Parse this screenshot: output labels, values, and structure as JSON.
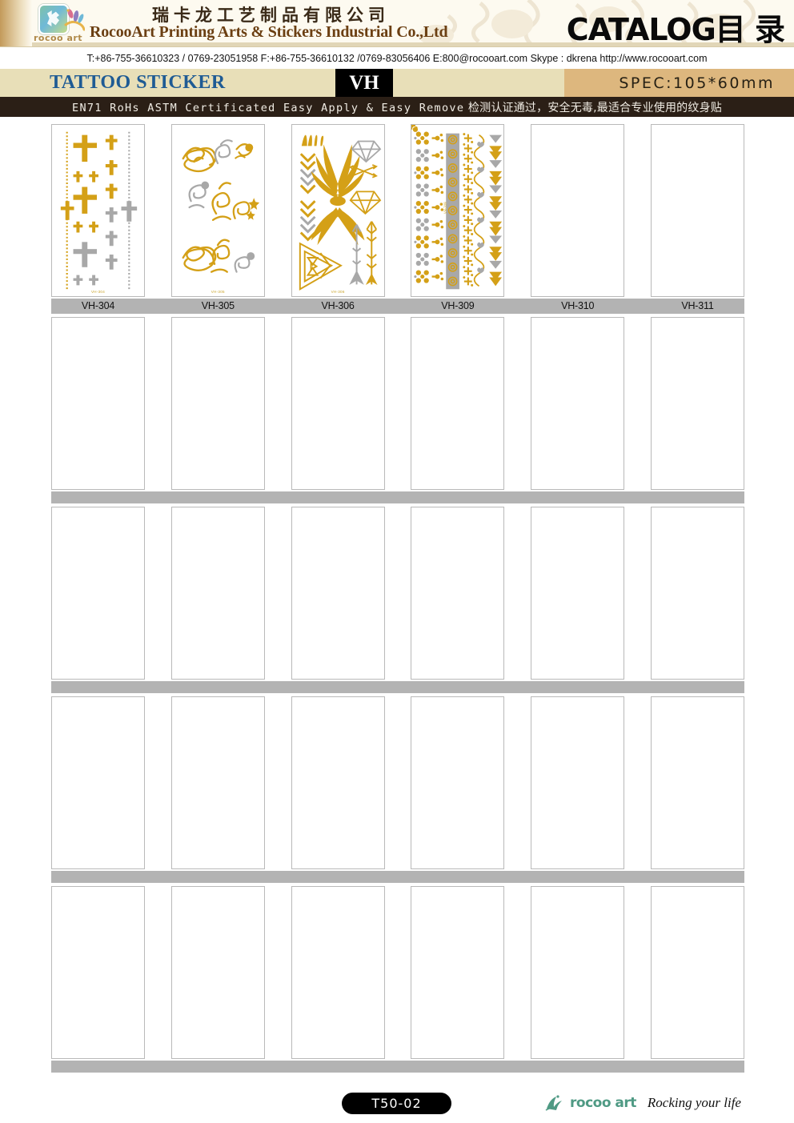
{
  "header": {
    "company_cn": "瑞卡龙工艺制品有限公司",
    "company_en": "RocooArt Printing Arts & Stickers Industrial Co.,Ltd",
    "catalog_label": "CATALOG目 录",
    "logo_word": "rocoo art",
    "contact": "T:+86-755-36610323 / 0769-23051958  F:+86-755-36610132 /0769-83056406   E:800@rocooart.com  Skype : dkrena   http://www.rocooart.com",
    "product_type": "TATTOO STICKER",
    "series_code": "VH",
    "spec": "SPEC:105*60mm",
    "certification_en": "EN71 RoHs ASTM Certificated Easy Apply & Easy Remove",
    "certification_cn": " 检测认证通过，安全无毒,最适合专业使用的纹身贴"
  },
  "colors": {
    "gold": "#d4a017",
    "silver": "#a8a8a8",
    "banner_bg": "#fdfaf0",
    "title_bar_bg": "#e8dfb8",
    "spec_bg": "#ddb77e",
    "cert_bar_bg": "#2b1f16",
    "label_bar_bg": "#b3b3b3",
    "title_blue": "#1f5b94",
    "company_brown": "#6b3f12",
    "brand_green": "#4f9a84"
  },
  "grid": {
    "columns": 6,
    "rows": 5,
    "labels_row1": [
      "VH-304",
      "VH-305",
      "VH-306",
      "VH-309",
      "VH-310",
      "VH-311"
    ],
    "products": [
      {
        "code": "VH-304",
        "art": "crosses",
        "filled": true,
        "description": "Gold and silver cross motifs in varying sizes with dotted vertical bands"
      },
      {
        "code": "VH-305",
        "art": "swirls",
        "filled": true,
        "description": "Gold and silver calligraphic swirl flourishes"
      },
      {
        "code": "VH-306",
        "art": "boho",
        "filled": true,
        "description": "Gold wings, arrows, chevrons, diamonds and tribal triangle"
      },
      {
        "code": "VH-309",
        "art": "bands",
        "filled": true,
        "description": "Gold and silver vertical bracelet band patterns with chevrons"
      },
      {
        "code": "VH-310",
        "art": "empty",
        "filled": false,
        "description": ""
      },
      {
        "code": "VH-311",
        "art": "empty",
        "filled": false,
        "description": ""
      }
    ]
  },
  "footer": {
    "page_code": "T50-02",
    "brand_name": "rocoo art",
    "tagline": "Rocking your life"
  }
}
